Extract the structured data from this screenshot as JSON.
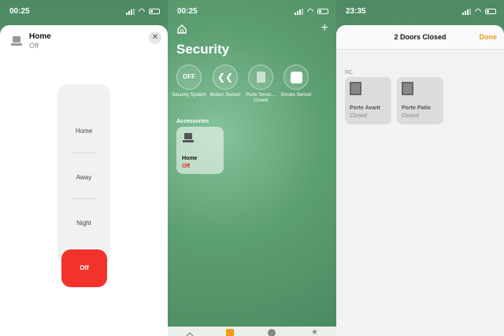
{
  "panel1": {
    "status": {
      "time": "00:25"
    },
    "accessory": {
      "name": "Home",
      "state": "Off"
    },
    "modes": [
      "Home",
      "Away",
      "Night"
    ],
    "selected_mode": "Off",
    "accent_color": "#f2322b"
  },
  "panel2": {
    "status": {
      "time": "00:25"
    },
    "title": "Security",
    "quick_items": [
      {
        "value": "OFF",
        "label": "Security System"
      },
      {
        "label": "Motion Sensor"
      },
      {
        "label": "Porte Servic... Closed"
      },
      {
        "label": "Smoke Sensor"
      }
    ],
    "accessories_label": "Accessories",
    "tile": {
      "name": "Home",
      "status": "Off",
      "status_color": "#e1251b"
    },
    "tabs": [
      "house-tab-icon",
      "rooms-tab-icon",
      "automation-tab-icon",
      "favorites-tab-icon"
    ]
  },
  "panel3": {
    "status": {
      "time": "23:35"
    },
    "title": "2 Doors Closed",
    "done_label": "Done",
    "section": "RC",
    "doors": [
      {
        "name": "Porte Avant",
        "status": "Closed"
      },
      {
        "name": "Porte Patio",
        "status": "Closed"
      }
    ],
    "done_color": "#f09a18"
  }
}
